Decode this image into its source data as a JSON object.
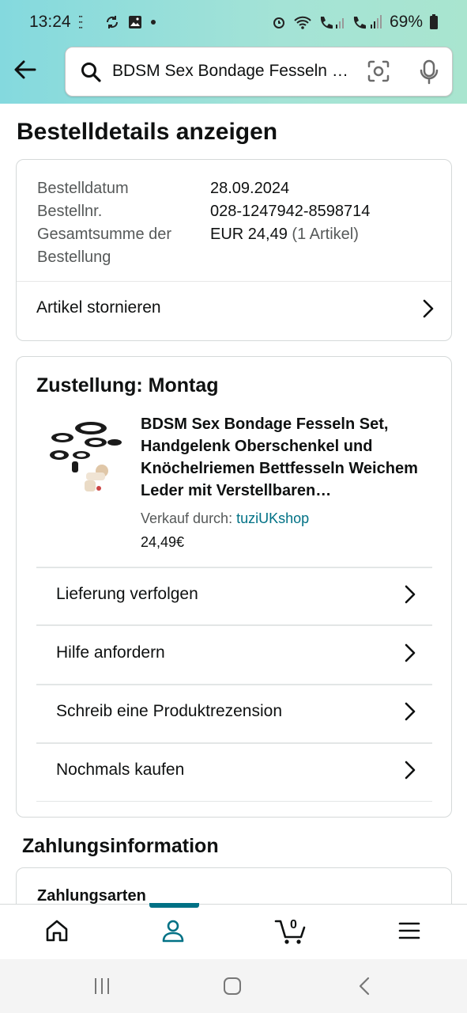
{
  "status": {
    "time": "13:24",
    "battery": "69%"
  },
  "search": {
    "query": "BDSM Sex Bondage Fesseln Set"
  },
  "page": {
    "title": "Bestelldetails anzeigen"
  },
  "order": {
    "date_label": "Bestelldatum",
    "date_value": "28.09.2024",
    "number_label": "Bestellnr.",
    "number_value": "028-1247942-8598714",
    "total_label_1": "Gesamtsumme der",
    "total_label_2": "Bestellung",
    "total_value": "EUR 24,49",
    "total_items": "(1 Artikel)",
    "cancel_label": "Artikel stornieren"
  },
  "delivery": {
    "title": "Zustellung: Montag",
    "product_title": "BDSM Sex Bondage Fesseln Set, Handgelenk Oberschenkel und Knöchelriemen Bettfesseln Weichem Leder mit Verstellbaren…",
    "seller_prefix": "Verkauf durch:",
    "seller_name": "tuziUKshop",
    "price": "24,49€",
    "actions": [
      {
        "label": "Lieferung verfolgen"
      },
      {
        "label": "Hilfe anfordern"
      },
      {
        "label": "Schreib eine Produktrezension"
      },
      {
        "label": "Nochmals kaufen"
      }
    ]
  },
  "payment": {
    "section_title": "Zahlungsinformation",
    "methods_title": "Zahlungsarten"
  },
  "bottom_nav": {
    "items": [
      {
        "icon": "home-icon"
      },
      {
        "icon": "account-icon"
      },
      {
        "icon": "cart-icon"
      },
      {
        "icon": "menu-icon"
      }
    ],
    "cart_count": "0",
    "accent_color": "#007185"
  }
}
